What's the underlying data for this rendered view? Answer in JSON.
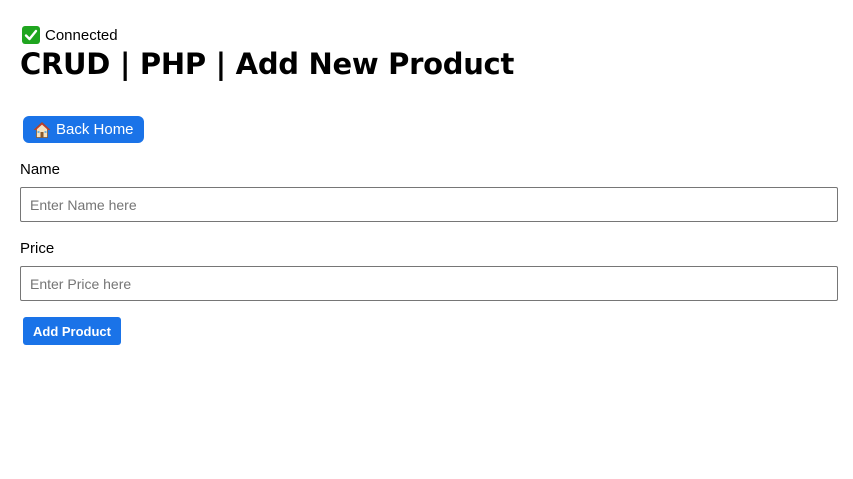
{
  "status": {
    "icon": "check-mark-icon",
    "icon_color": "#1fa51f",
    "text": "Connected"
  },
  "header": {
    "title": "CRUD | PHP | Add New Product"
  },
  "nav": {
    "back_icon": "house-icon",
    "back_label": "Back Home",
    "button_color": "#1a73e8"
  },
  "form": {
    "name_label": "Name",
    "name_placeholder": "Enter Name here",
    "name_value": "",
    "price_label": "Price",
    "price_placeholder": "Enter Price here",
    "price_value": "",
    "submit_label": "Add Product"
  }
}
